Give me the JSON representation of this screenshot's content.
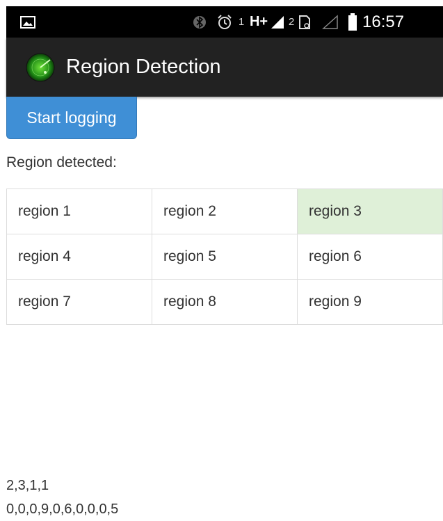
{
  "status_bar": {
    "time": "16:57",
    "sim1_label": "1",
    "network_type": "H+",
    "sim2_label": "2",
    "icons": [
      "picture-icon",
      "bluetooth-icon",
      "alarm-icon",
      "signal-icon",
      "sim-card-icon",
      "signal-empty-icon",
      "battery-icon"
    ]
  },
  "action_bar": {
    "title": "Region Detection",
    "icon": "radar-icon"
  },
  "main": {
    "start_button_label": "Start logging",
    "region_label": "Region detected:",
    "active_region": "region 3",
    "active_color": "#dff0d8",
    "regions": [
      [
        "region 1",
        "region 2",
        "region 3"
      ],
      [
        "region 4",
        "region 5",
        "region 6"
      ],
      [
        "region 7",
        "region 8",
        "region 9"
      ]
    ],
    "output_line_1": "2,3,1,1",
    "output_line_2": "0,0,0,9,0,6,0,0,0,5"
  },
  "colors": {
    "status_bar_bg": "#000000",
    "action_bar_bg": "#222222",
    "button_bg": "#3f8fd6"
  }
}
